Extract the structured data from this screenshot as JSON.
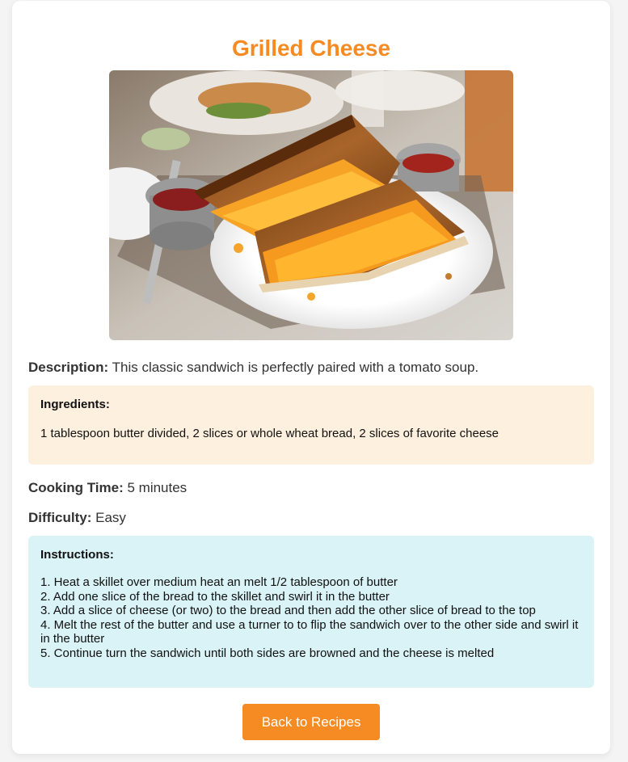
{
  "recipe": {
    "title": "Grilled Cheese",
    "image_alt": "grilled-cheese-sandwich-photo",
    "description_label": "Description:",
    "description": "This classic sandwich is perfectly paired with a tomato soup.",
    "ingredients_heading": "Ingredients:",
    "ingredients": "1 tablespoon butter divided, 2 slices or whole wheat bread, 2 slices of favorite cheese",
    "cooking_time_label": "Cooking Time:",
    "cooking_time": "5 minutes",
    "difficulty_label": "Difficulty:",
    "difficulty": "Easy",
    "instructions_heading": "Instructions:",
    "instructions": [
      "1. Heat a skillet over medium heat an melt 1/2 tablespoon of butter",
      "2. Add one slice of the bread to the skillet and swirl it in the butter",
      "3. Add a slice of cheese (or two) to the bread and then add the other slice of bread to the top",
      "4. Melt the rest of the butter and use a turner to to flip the sandwich over to the other side and swirl it in the butter",
      "5. Continue turn the sandwich until both sides are browned and the cheese is melted"
    ]
  },
  "actions": {
    "back_label": "Back to Recipes"
  },
  "colors": {
    "accent": "#f68b24",
    "ingredients_bg": "#fef0de",
    "instructions_bg": "#d9f3f7",
    "card_bg": "#ffffff",
    "page_bg": "#f4f4f4"
  }
}
